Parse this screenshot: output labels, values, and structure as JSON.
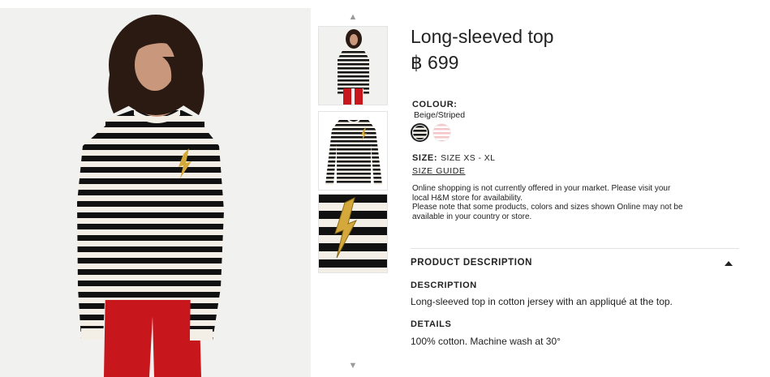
{
  "product": {
    "title": "Long-sleeved top",
    "price": "฿ 699"
  },
  "colour": {
    "label": "COLOUR:",
    "value": "Beige/Striped",
    "swatches": [
      {
        "name": "Beige/Striped",
        "selected": true,
        "color": "#111111"
      },
      {
        "name": "Pink/Striped",
        "selected": false,
        "color": "#f5c6c8"
      }
    ]
  },
  "size": {
    "label": "SIZE:",
    "value": "SIZE XS - XL",
    "guide_label": "SIZE GUIDE"
  },
  "notice": {
    "line1": "Online shopping is not currently offered in your market. Please visit your local H&M store for availability.",
    "line2": "Please note that some products, colors and sizes shown Online may not be available in your country or store."
  },
  "product_description": {
    "header": "PRODUCT DESCRIPTION",
    "expanded": true,
    "description_label": "DESCRIPTION",
    "description_text": "Long-sleeved top in cotton jersey with an appliqué at the top.",
    "details_label": "DETAILS",
    "details_text": "100% cotton. Machine wash at 30°"
  },
  "gallery": {
    "up_arrow": "▲",
    "down_arrow": "▼",
    "thumbnail_count": 3
  },
  "colors": {
    "stripe_dark": "#111111",
    "stripe_light": "#f3efe6",
    "trousers": "#c8161d",
    "hair": "#2a1a12",
    "skin": "#c9977c",
    "patch_gold": "#d4a83a",
    "background": "#f1f1ef"
  }
}
